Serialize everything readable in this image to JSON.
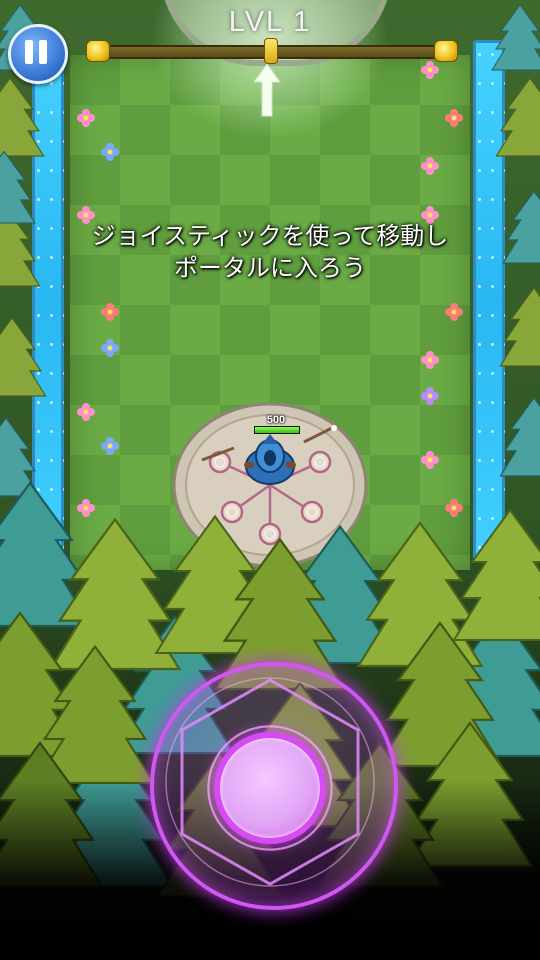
{
  "hud": {
    "level_label": "LVL 1",
    "pause_icon": "pause-icon"
  },
  "tutorial": {
    "line1": "ジョイスティックを使って移動し",
    "line2": "ポータルに入ろう"
  },
  "player": {
    "hp_text": "500",
    "hp_fraction": 1.0
  },
  "colors": {
    "river": "#2fb8f3",
    "grass": "#5f9d3e",
    "joystick_accent": "#d64bf4",
    "level_gold": "#f0c21b",
    "pause_blue": "#3a79d6"
  }
}
